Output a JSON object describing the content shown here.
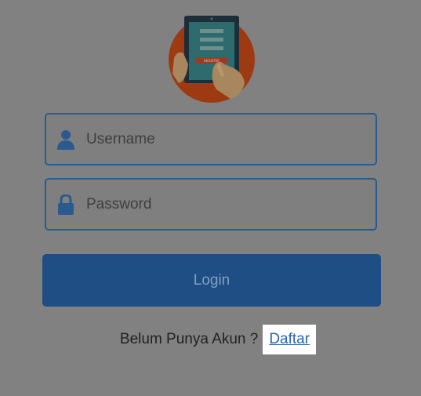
{
  "form": {
    "username_placeholder": "Username",
    "username_value": "",
    "password_placeholder": "Password",
    "password_value": "",
    "login_label": "Login"
  },
  "logo": {
    "screen_button_text": "REGISTER"
  },
  "signup": {
    "prompt": "Belum Punya Akun ?",
    "link_label": "Daftar"
  },
  "icons": {
    "user": "user-icon",
    "password": "lock-icon"
  },
  "colors": {
    "background": "#818181",
    "accent": "#1f4e84",
    "field_border": "#2b5b8e",
    "link": "#2a66a8",
    "logo_circle": "#9e3a12"
  }
}
